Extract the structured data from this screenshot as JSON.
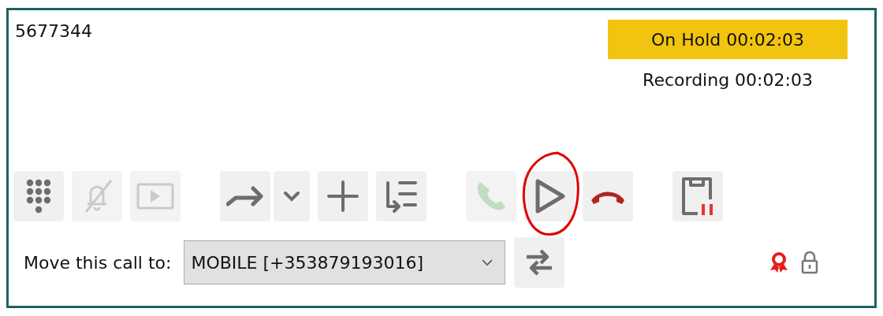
{
  "call": {
    "number": "5677344",
    "hold_status": "On Hold 00:02:03",
    "recording_status": "Recording 00:02:03"
  },
  "toolbar_groups": [
    [
      {
        "kind": "dialpad",
        "disabled": false
      },
      {
        "kind": "mute",
        "disabled": true
      },
      {
        "kind": "video",
        "disabled": true
      }
    ],
    [
      {
        "kind": "forward",
        "disabled": false
      },
      {
        "kind": "caret",
        "disabled": false
      },
      {
        "kind": "add",
        "disabled": false
      },
      {
        "kind": "transfer",
        "disabled": false
      }
    ],
    [
      {
        "kind": "answer",
        "disabled": true
      },
      {
        "kind": "resume",
        "disabled": false,
        "circled": true
      },
      {
        "kind": "hangup",
        "disabled": false
      }
    ],
    [
      {
        "kind": "recording",
        "disabled": false
      }
    ]
  ],
  "move_call": {
    "label": "Move this call to:",
    "value": "MOBILE [+353879193016]"
  }
}
